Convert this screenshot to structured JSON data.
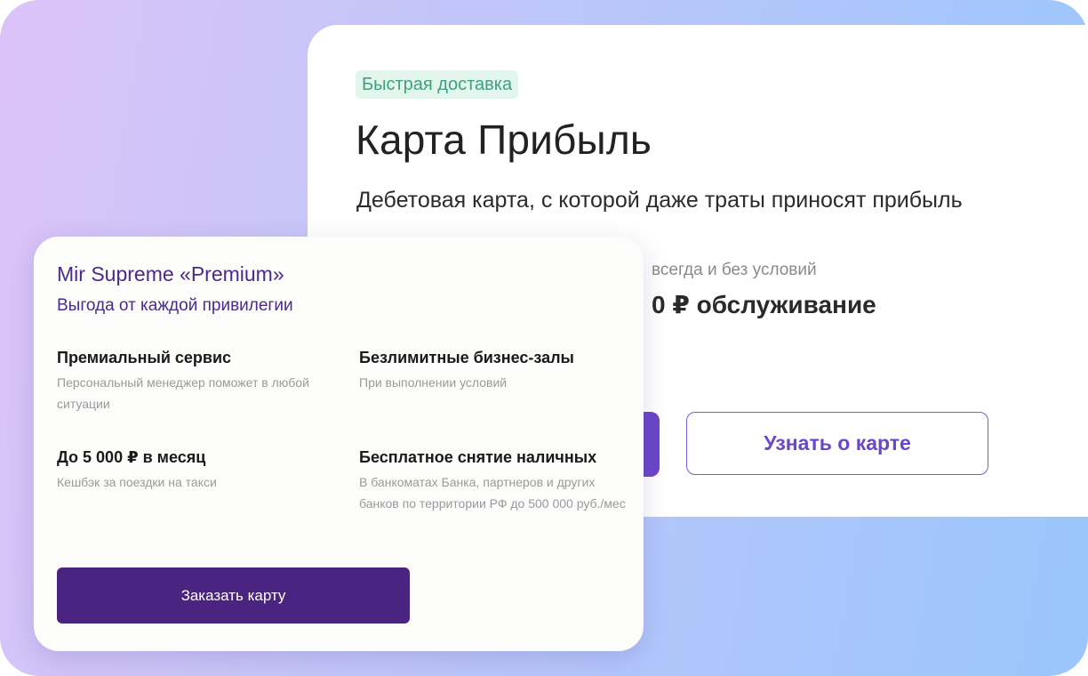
{
  "background_card": {
    "badge": "Быстрая доставка",
    "title": "Карта Прибыль",
    "subtitle": "Дебетовая карта, с которой даже траты приносят прибыль",
    "feature_small": "всегда и без условий",
    "feature_big": "0 ₽ обслуживание",
    "learn_button": "Узнать о карте"
  },
  "front_card": {
    "title": "Mir Supreme «Premium»",
    "subtitle": "Выгода от каждой привилегии",
    "features": [
      {
        "title": "Премиальный сервис",
        "desc": "Персональный менеджер поможет в любой ситуации"
      },
      {
        "title": "Безлимитные бизнес-залы",
        "desc": "При выполнении условий"
      },
      {
        "title": "До 5 000 ₽ в месяц",
        "desc": "Кешбэк за поездки на такси"
      },
      {
        "title": "Бесплатное снятие наличных",
        "desc": "В банкоматах Банка, партнеров и других банков по территории РФ до 500 000 руб./мес"
      }
    ],
    "order_button": "Заказать карту"
  },
  "colors": {
    "accent_purple": "#6a46c8",
    "dark_purple": "#4a2480",
    "badge_green": "#3e9f7f"
  }
}
